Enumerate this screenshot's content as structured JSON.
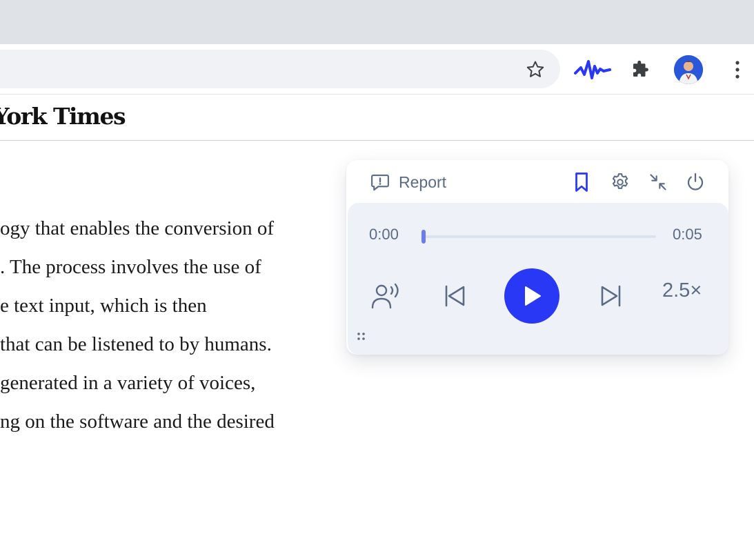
{
  "browser": {
    "toolbar_icons": [
      "star-icon",
      "speechify-icon",
      "puzzle-icon",
      "avatar",
      "kebab-menu-icon"
    ]
  },
  "site": {
    "masthead": "York Times"
  },
  "article": {
    "lines": [
      "ogy that enables the conversion of",
      ". The process involves the use of",
      "e text input, which is then",
      "that can be listened to by humans.",
      "generated in a variety of voices,",
      "ng on the software and the desired"
    ]
  },
  "player": {
    "report_label": "Report",
    "current_time": "0:00",
    "duration": "0:05",
    "progress": 0.0,
    "speed": "2.5×",
    "accent_color": "#2838f5",
    "icon_color": "#5b6b86"
  }
}
